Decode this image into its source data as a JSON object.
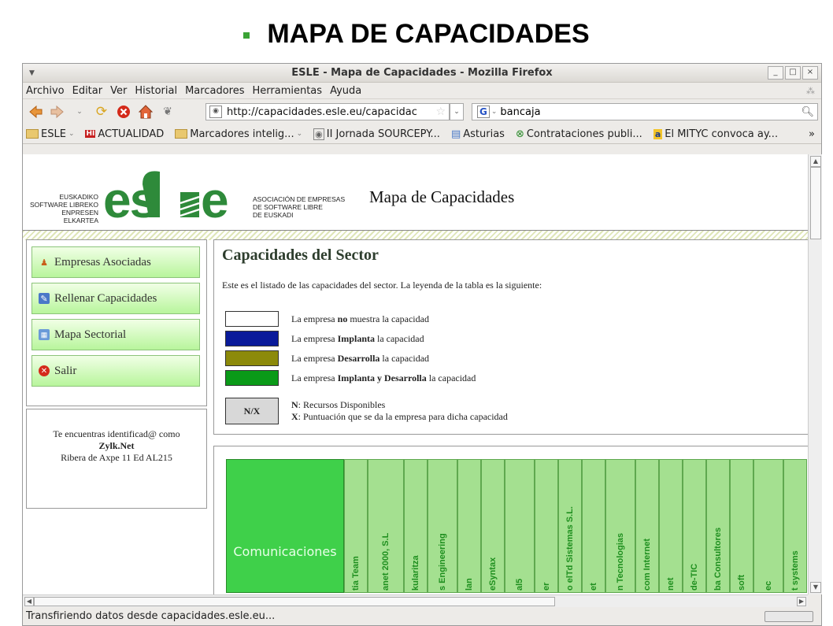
{
  "slide_title": "MAPA DE CAPACIDADES",
  "window": {
    "title": "ESLE - Mapa de Capacidades - Mozilla Firefox",
    "min_label": "_",
    "max_label": "□",
    "close_label": "×"
  },
  "menu": [
    "Archivo",
    "Editar",
    "Ver",
    "Historial",
    "Marcadores",
    "Herramientas",
    "Ayuda"
  ],
  "url": "http://capacidades.esle.eu/capacidac",
  "search": "bancaja",
  "bookmarks": [
    "ESLE",
    "ACTUALIDAD",
    "Marcadores intelig...",
    "II Jornada SOURCEPY...",
    "Asturias",
    "Contrataciones publi...",
    "El MITYC convoca ay..."
  ],
  "page": {
    "logo_left": [
      "EUSKADIKO",
      "SOFTWARE LIBREKO",
      "ENPRESEN ELKARTEA"
    ],
    "logo_word": "esle",
    "logo_right": [
      "ASOCIACIÓN DE EMPRESAS",
      "DE SOFTWARE LIBRE",
      "DE EUSKADI"
    ],
    "header_title": "Mapa de Capacidades",
    "nav": [
      "Empresas Asociadas",
      "Rellenar Capacidades",
      "Mapa Sectorial",
      "Salir"
    ],
    "user": {
      "line1": "Te encuentras identificad@ como",
      "name": "Zylk.Net",
      "address": "Ribera de Axpe 11 Ed AL215"
    },
    "section_title": "Capacidades del Sector",
    "intro": "Este es el listado de las capacidades del sector. La leyenda de la tabla es la siguiente:",
    "legend": [
      {
        "color": "#ffffff",
        "pre": "La empresa ",
        "bold": "no",
        "post": " muestra la capacidad"
      },
      {
        "color": "#0a1a9a",
        "pre": "La empresa ",
        "bold": "Implanta",
        "post": " la capacidad"
      },
      {
        "color": "#8c8a0a",
        "pre": "La empresa ",
        "bold": "Desarrolla",
        "post": " la capacidad"
      },
      {
        "color": "#0a9a18",
        "pre": "La empresa ",
        "bold": "Implanta y Desarrolla",
        "post": " la capacidad"
      }
    ],
    "nx_label": "N/X",
    "nx_n_bold": "N",
    "nx_n_text": ": Recursos Disponibles",
    "nx_x_bold": "X",
    "nx_x_text": ": Puntuación que se da la empresa para dicha capacidad",
    "category": "Comunicaciones",
    "companies": [
      "tia Team",
      "anet 2000, S.L",
      "kularitza",
      "s Engineering",
      "lan",
      "eSyntax",
      "al5",
      "er",
      "o elTd Sistemas S.L.",
      "et",
      "n Tecnologias",
      "com Internet",
      "net",
      "de-TIC",
      "ba Consultores",
      "soft",
      "ec",
      "t systems"
    ]
  },
  "status": "Transfiriendo datos desde capacidades.esle.eu..."
}
